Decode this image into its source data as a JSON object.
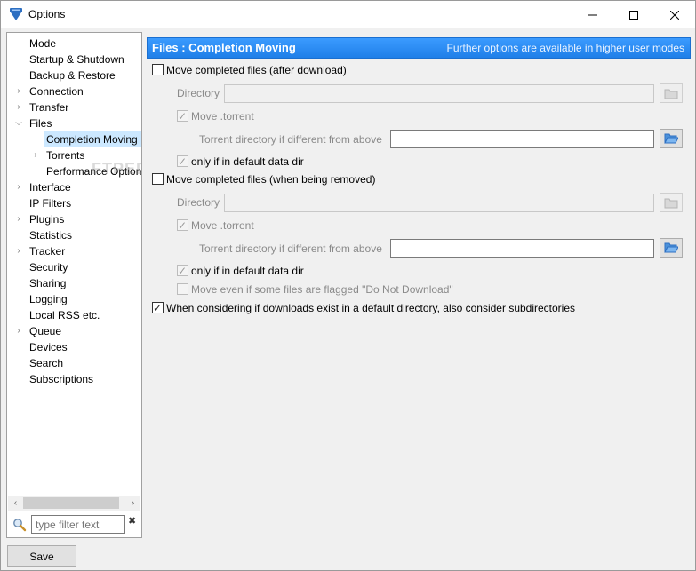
{
  "window": {
    "title": "Options"
  },
  "sidebar": {
    "items": [
      {
        "label": "Mode",
        "arrow": ""
      },
      {
        "label": "Startup & Shutdown",
        "arrow": ""
      },
      {
        "label": "Backup & Restore",
        "arrow": ""
      },
      {
        "label": "Connection",
        "arrow": ">"
      },
      {
        "label": "Transfer",
        "arrow": ">"
      },
      {
        "label": "Files",
        "arrow": "v"
      },
      {
        "label": "Completion Moving",
        "arrow": ""
      },
      {
        "label": "Torrents",
        "arrow": ">"
      },
      {
        "label": "Performance Option",
        "arrow": ""
      },
      {
        "label": "Interface",
        "arrow": ">"
      },
      {
        "label": "IP Filters",
        "arrow": ""
      },
      {
        "label": "Plugins",
        "arrow": ">"
      },
      {
        "label": "Statistics",
        "arrow": ""
      },
      {
        "label": "Tracker",
        "arrow": ">"
      },
      {
        "label": "Security",
        "arrow": ""
      },
      {
        "label": "Sharing",
        "arrow": ""
      },
      {
        "label": "Logging",
        "arrow": ""
      },
      {
        "label": "Local RSS etc.",
        "arrow": ""
      },
      {
        "label": "Queue",
        "arrow": ">"
      },
      {
        "label": "Devices",
        "arrow": ""
      },
      {
        "label": "Search",
        "arrow": ""
      },
      {
        "label": "Subscriptions",
        "arrow": ""
      }
    ],
    "selected": "Completion Moving",
    "watermark": "FTPEDIA",
    "filter_placeholder": "type filter text"
  },
  "header": {
    "title": "Files : Completion Moving",
    "note": "Further options are available in higher user modes"
  },
  "options": {
    "move_after_download": {
      "label": "Move completed files (after download)",
      "checked": false
    },
    "directory_label": "Directory",
    "move_torrent_1": {
      "label": "Move .torrent",
      "checked": true
    },
    "torrent_dir_label_1": "Torrent directory if different from above",
    "only_default_1": {
      "label": "only if in default data dir",
      "checked": true
    },
    "move_when_removed": {
      "label": "Move completed files (when being removed)",
      "checked": false
    },
    "directory_label_2": "Directory",
    "move_torrent_2": {
      "label": "Move .torrent",
      "checked": true
    },
    "torrent_dir_label_2": "Torrent directory if different from above",
    "only_default_2": {
      "label": "only if in default data dir",
      "checked": true
    },
    "move_even_flagged": {
      "label": "Move even if some files are flagged \"Do Not Download\"",
      "checked": false
    },
    "consider_subdirs": {
      "label": "When considering if downloads exist in a default directory, also consider subdirectories",
      "checked": true
    }
  },
  "footer": {
    "save_label": "Save"
  },
  "colors": {
    "header_bg": "#1f7fe8",
    "selected_bg": "#cce8ff"
  }
}
